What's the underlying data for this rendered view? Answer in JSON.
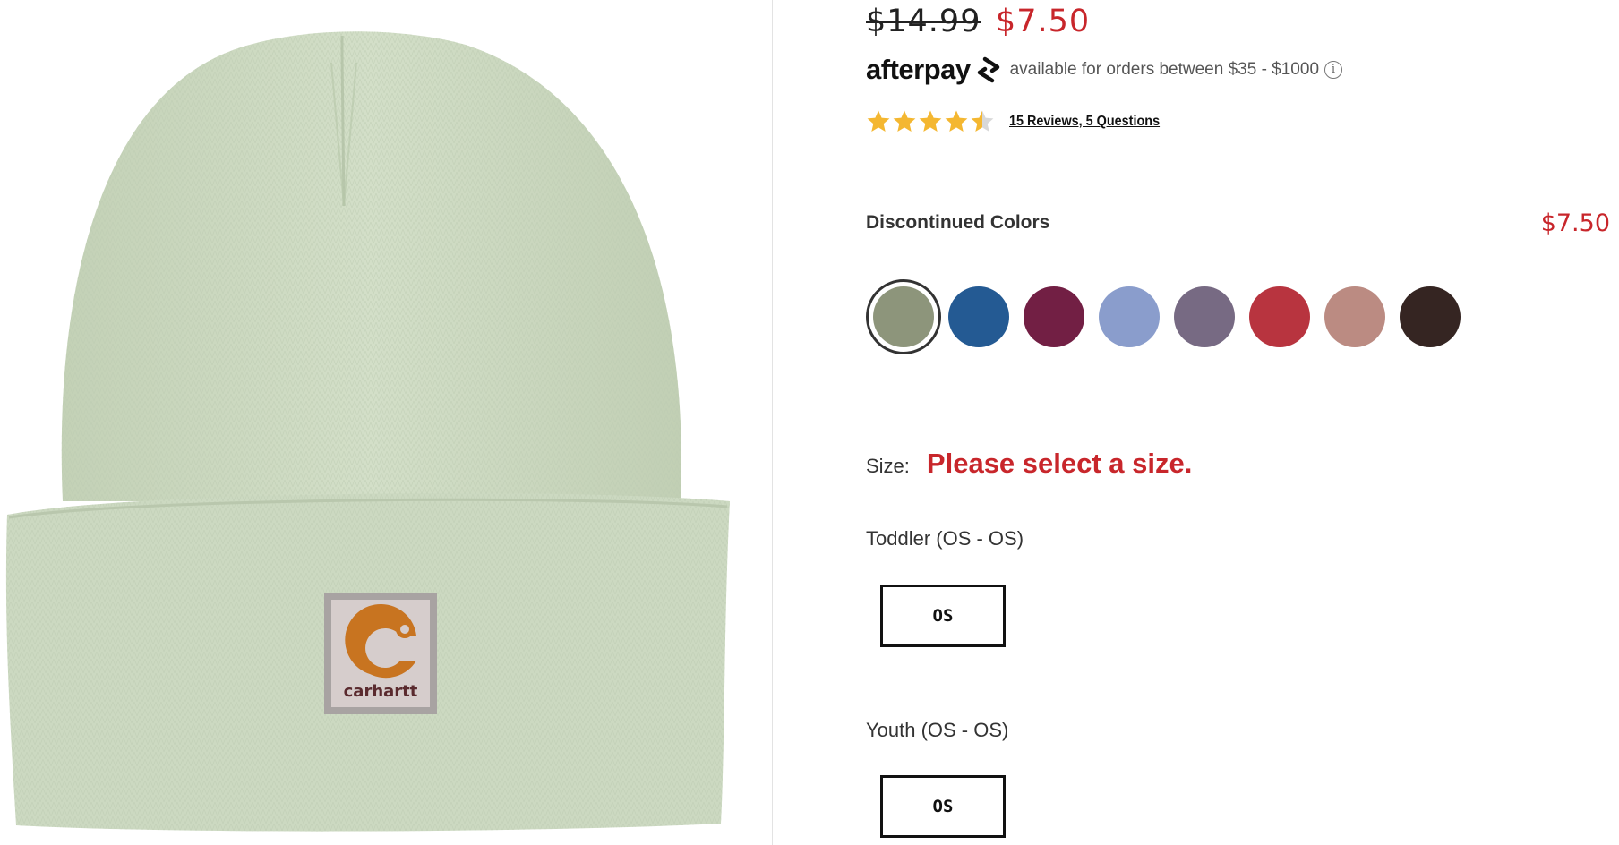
{
  "product_image": {
    "alt_icon": "beanie-product-image",
    "patch_text": "carhartt",
    "color": "#cfdbc4"
  },
  "pricing": {
    "original_price": "$14.99",
    "sale_price": "$7.50",
    "sale_color": "#c8262b"
  },
  "afterpay": {
    "logo_text": "afterpay",
    "message": "available for orders between $35 - $1000",
    "info_symbol": "i"
  },
  "rating": {
    "stars": 4.5,
    "max_stars": 5,
    "reviews_link": "15 Reviews, 5 Questions"
  },
  "colors": {
    "label": "Discontinued Colors",
    "price": "$7.50",
    "swatches": [
      {
        "color": "#8d957b",
        "selected": true
      },
      {
        "color": "#245a93",
        "selected": false
      },
      {
        "color": "#721f44",
        "selected": false
      },
      {
        "color": "#8a9dcc",
        "selected": false
      },
      {
        "color": "#776a83",
        "selected": false
      },
      {
        "color": "#b8343f",
        "selected": false
      },
      {
        "color": "#bb8b82",
        "selected": false
      },
      {
        "color": "#352522",
        "selected": false
      }
    ]
  },
  "size": {
    "label": "Size:",
    "error": "Please select a size.",
    "groups": [
      {
        "label": "Toddler (OS - OS)",
        "option": "OS"
      },
      {
        "label": "Youth (OS - OS)",
        "option": "OS"
      }
    ]
  }
}
